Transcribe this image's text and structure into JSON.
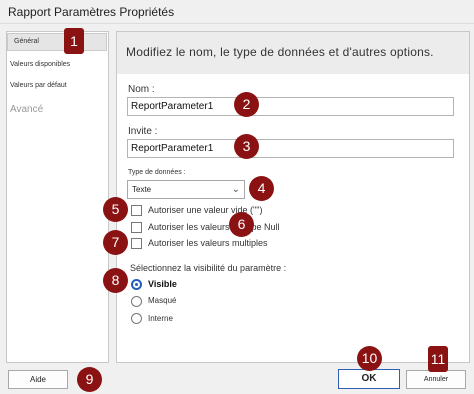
{
  "window": {
    "title": "Rapport Paramètres Propriétés"
  },
  "sidebar": {
    "items": [
      {
        "label": "Général",
        "selected": true
      },
      {
        "label": "Valeurs disponibles"
      },
      {
        "label": "Valeurs par défaut"
      },
      {
        "label": "Avancé",
        "disabled": true
      }
    ]
  },
  "panel": {
    "header": "Modifiez le nom, le type de données et d'autres options.",
    "name_label": "Nom :",
    "name_value": "ReportParameter1",
    "prompt_label": "Invite :",
    "prompt_value": "ReportParameter1",
    "datatype_label": "Type de données :",
    "datatype_value": "Texte",
    "checkboxes": [
      {
        "label": "Autoriser une valeur vide (\"\")",
        "checked": false
      },
      {
        "label": "Autoriser les valeurs de type Null",
        "checked": false
      },
      {
        "label": "Autoriser les valeurs multiples",
        "checked": false
      }
    ],
    "visibility_label": "Sélectionnez la visibilité du paramètre :",
    "visibility_options": [
      {
        "label": "Visible",
        "selected": true
      },
      {
        "label": "Masqué",
        "selected": false
      },
      {
        "label": "Interne",
        "selected": false
      }
    ]
  },
  "footer": {
    "help": "Aide",
    "ok": "OK",
    "cancel": "Annuler"
  },
  "markers": [
    "1",
    "2",
    "3",
    "4",
    "5",
    "6",
    "7",
    "8",
    "9",
    "10",
    "11"
  ],
  "colors": {
    "marker": "#8a1212",
    "ok_border": "#2f5fb5",
    "radio_selected": "#1f5fbf"
  }
}
